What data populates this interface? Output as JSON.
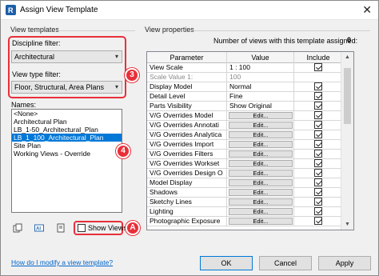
{
  "window": {
    "title": "Assign View Template",
    "close_glyph": "✕"
  },
  "left": {
    "group_label": "View templates",
    "discipline_label": "Discipline filter:",
    "discipline_value": "Architectural",
    "view_type_label": "View type filter:",
    "view_type_value": "Floor, Structural, Area Plans",
    "names_label": "Names:",
    "names": [
      "<None>",
      "Architectural Plan",
      "LB_1-50_Architectural_Plan",
      "LB_1_100_Architectural_Plan",
      "Site Plan",
      "Working Views - Override"
    ],
    "selected_index": 3,
    "show_views_label": "Show Views",
    "show_views_checked": false
  },
  "markers": {
    "m3": "3",
    "m4": "4",
    "mA": "A"
  },
  "right": {
    "group_label": "View properties",
    "count_label": "Number of views with this template assigned:",
    "count_value": "0",
    "columns": [
      "Parameter",
      "Value",
      "Include"
    ],
    "rows": [
      {
        "param": "View Scale",
        "value": "1 : 100",
        "include": true
      },
      {
        "param": "Scale Value   1:",
        "value": "100",
        "include": null
      },
      {
        "param": "Display Model",
        "value": "Normal",
        "include": true
      },
      {
        "param": "Detail Level",
        "value": "Fine",
        "include": true
      },
      {
        "param": "Parts Visibility",
        "value": "Show Original",
        "include": true
      },
      {
        "param": "V/G Overrides Model",
        "value": "Edit...",
        "include": true
      },
      {
        "param": "V/G Overrides Annotati",
        "value": "Edit...",
        "include": true
      },
      {
        "param": "V/G Overrides Analytica",
        "value": "Edit...",
        "include": true
      },
      {
        "param": "V/G Overrides Import",
        "value": "Edit...",
        "include": true
      },
      {
        "param": "V/G Overrides Filters",
        "value": "Edit...",
        "include": true
      },
      {
        "param": "V/G Overrides Workset",
        "value": "Edit...",
        "include": true
      },
      {
        "param": "V/G Overrides Design O",
        "value": "Edit...",
        "include": true
      },
      {
        "param": "Model Display",
        "value": "Edit...",
        "include": true
      },
      {
        "param": "Shadows",
        "value": "Edit...",
        "include": true
      },
      {
        "param": "Sketchy Lines",
        "value": "Edit...",
        "include": true
      },
      {
        "param": "Lighting",
        "value": "Edit...",
        "include": true
      },
      {
        "param": "Photographic Exposure",
        "value": "Edit...",
        "include": true
      }
    ]
  },
  "footer": {
    "help_link": "How do I modify a view template?",
    "ok": "OK",
    "cancel": "Cancel",
    "apply": "Apply"
  },
  "colors": {
    "accent": "#0078d7",
    "marker": "#e8303a"
  }
}
